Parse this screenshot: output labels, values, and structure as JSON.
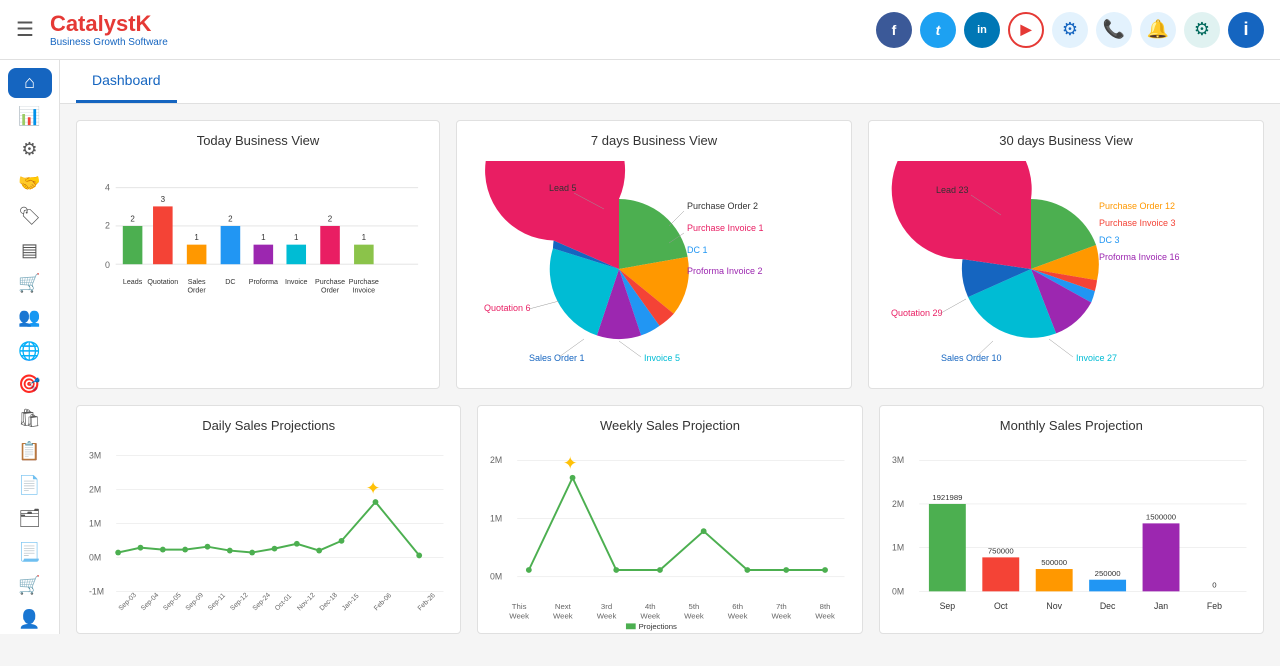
{
  "header": {
    "brand": "CatalystK",
    "tagline": "Business Growth Software",
    "menu_icon": "☰",
    "social": [
      {
        "name": "facebook",
        "label": "f",
        "class": "si-fb"
      },
      {
        "name": "twitter",
        "label": "t",
        "class": "si-tw"
      },
      {
        "name": "linkedin",
        "label": "in",
        "class": "si-li"
      },
      {
        "name": "youtube",
        "label": "▶",
        "class": "si-yt"
      }
    ]
  },
  "tabs": [
    {
      "label": "Dashboard",
      "active": true
    }
  ],
  "sidebar": {
    "items": [
      {
        "icon": "⌂",
        "name": "home",
        "active": true
      },
      {
        "icon": "📊",
        "name": "analytics",
        "active": false
      },
      {
        "icon": "⚙",
        "name": "operations",
        "active": false
      },
      {
        "icon": "👥",
        "name": "people",
        "active": false
      },
      {
        "icon": "🏷",
        "name": "tags",
        "active": false
      },
      {
        "icon": "☰",
        "name": "list",
        "active": false
      },
      {
        "icon": "🛒",
        "name": "cart",
        "active": false
      },
      {
        "icon": "👤",
        "name": "user-group",
        "active": false
      },
      {
        "icon": "🌐",
        "name": "globe",
        "active": false
      },
      {
        "icon": "🎯",
        "name": "target",
        "active": false
      },
      {
        "icon": "🛍",
        "name": "shopping",
        "active": false
      },
      {
        "icon": "📋",
        "name": "report",
        "active": false
      },
      {
        "icon": "📄",
        "name": "document",
        "active": false
      },
      {
        "icon": "🗂",
        "name": "files",
        "active": false
      },
      {
        "icon": "📃",
        "name": "invoice",
        "active": false
      },
      {
        "icon": "🛒",
        "name": "purchase",
        "active": false
      },
      {
        "icon": "👤",
        "name": "profile",
        "active": false
      }
    ]
  },
  "today_chart": {
    "title": "Today Business View",
    "bars": [
      {
        "label": "Leads",
        "value": 2,
        "color": "#4caf50"
      },
      {
        "label": "Quotation",
        "value": 3,
        "color": "#f44336"
      },
      {
        "label": "Sales Order",
        "value": 1,
        "color": "#ff9800"
      },
      {
        "label": "DC",
        "value": 2,
        "color": "#2196f3"
      },
      {
        "label": "Proforma",
        "value": 1,
        "color": "#9c27b0"
      },
      {
        "label": "Invoice",
        "value": 1,
        "color": "#00bcd4"
      },
      {
        "label": "Purchase Order",
        "value": 2,
        "color": "#e91e63"
      },
      {
        "label": "Purchase Invoice",
        "value": 1,
        "color": "#8bc34a"
      }
    ],
    "y_max": 4
  },
  "seven_day_chart": {
    "title": "7 days Business View",
    "slices": [
      {
        "label": "Lead 5",
        "value": 5,
        "color": "#4caf50"
      },
      {
        "label": "Purchase Order 2",
        "value": 2,
        "color": "#ff9800"
      },
      {
        "label": "Purchase Invoice 1",
        "value": 1,
        "color": "#f44336"
      },
      {
        "label": "DC 1",
        "value": 1,
        "color": "#2196f3"
      },
      {
        "label": "Proforma Invoice 2",
        "value": 2,
        "color": "#9c27b0"
      },
      {
        "label": "Invoice 5",
        "value": 5,
        "color": "#00bcd4"
      },
      {
        "label": "Sales Order 1",
        "value": 1,
        "color": "#1565c0"
      },
      {
        "label": "Quotation 6",
        "value": 6,
        "color": "#e91e63"
      }
    ]
  },
  "thirty_day_chart": {
    "title": "30 days Business View",
    "slices": [
      {
        "label": "Lead 23",
        "value": 23,
        "color": "#4caf50"
      },
      {
        "label": "Purchase Order 12",
        "value": 12,
        "color": "#ff9800"
      },
      {
        "label": "Purchase Invoice 3",
        "value": 3,
        "color": "#f44336"
      },
      {
        "label": "DC 3",
        "value": 3,
        "color": "#2196f3"
      },
      {
        "label": "Proforma Invoice 16",
        "value": 16,
        "color": "#9c27b0"
      },
      {
        "label": "Invoice 27",
        "value": 27,
        "color": "#00bcd4"
      },
      {
        "label": "Sales Order 10",
        "value": 10,
        "color": "#1565c0"
      },
      {
        "label": "Quotation 29",
        "value": 29,
        "color": "#e91e63"
      }
    ]
  },
  "daily_projection": {
    "title": "Daily Sales Projections",
    "x_labels": [
      "Sep-03",
      "Sep-04",
      "Sep-05",
      "Sep-09",
      "Sep-11",
      "Sep-12",
      "Sep-24",
      "Oct-01",
      "Nov-12",
      "Dec-18",
      "Jan-15",
      "Feb-06",
      "Feb-26"
    ],
    "y_labels": [
      "3M",
      "2M",
      "1M",
      "0M",
      "-1M"
    ],
    "line_color": "#4caf50"
  },
  "weekly_projection": {
    "title": "Weekly Sales Projection",
    "x_labels": [
      "This Week",
      "Next Week",
      "3rd Week",
      "4th Week",
      "5th Week",
      "6th Week",
      "7th Week",
      "8th Week"
    ],
    "y_labels": [
      "2M",
      "1M",
      "0M"
    ],
    "line_color": "#4caf50"
  },
  "monthly_projection": {
    "title": "Monthly Sales Projection",
    "bars": [
      {
        "label": "Sep",
        "value": 1921989,
        "color": "#4caf50"
      },
      {
        "label": "Oct",
        "value": 750000,
        "color": "#f44336"
      },
      {
        "label": "Nov",
        "value": 500000,
        "color": "#ff9800"
      },
      {
        "label": "Dec",
        "value": 250000,
        "color": "#2196f3"
      },
      {
        "label": "Jan",
        "value": 1500000,
        "color": "#9c27b0"
      },
      {
        "label": "Feb",
        "value": 0,
        "color": "#4caf50"
      }
    ],
    "y_labels": [
      "3M",
      "2M",
      "1M",
      "0M"
    ],
    "value_labels": [
      "1921989",
      "750000",
      "500000",
      "250000",
      "1500000",
      "0"
    ]
  }
}
